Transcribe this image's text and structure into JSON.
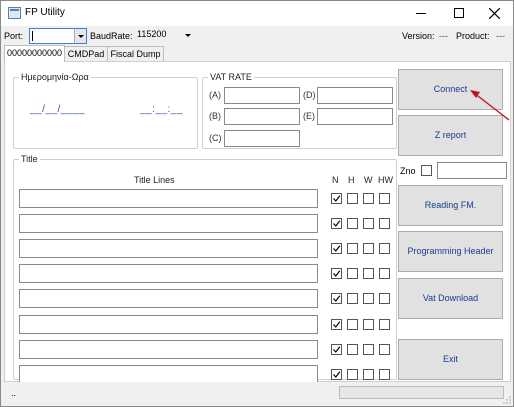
{
  "window": {
    "title": "FP Utility"
  },
  "toolbar": {
    "port_label": "Port:",
    "port_value": "",
    "baud_label": "BaudRate:",
    "baud_value": "115200",
    "version_label": "Version:",
    "version_value": "---",
    "product_label": "Product:",
    "product_value": "---"
  },
  "tabs": [
    {
      "label": "00000000000"
    },
    {
      "label": "CMDPad"
    },
    {
      "label": "Fiscal Dump"
    }
  ],
  "datetime": {
    "label": "Ημερομηνία-Ωρα",
    "date_value": "__/__/____",
    "time_value": "__:__:__"
  },
  "vat": {
    "label": "VAT RATE",
    "rates": [
      {
        "label": "(A)",
        "value": ""
      },
      {
        "label": "(B)",
        "value": ""
      },
      {
        "label": "(C)",
        "value": ""
      },
      {
        "label": "(D)",
        "value": ""
      },
      {
        "label": "(E)",
        "value": ""
      }
    ]
  },
  "title_group": {
    "label": "Title",
    "lines_header": "Title Lines",
    "col_n": "N",
    "col_h": "H",
    "col_w": "W",
    "col_hw": "HW",
    "rows": [
      {
        "value": "",
        "n": true,
        "h": false,
        "w": false,
        "hw": false
      },
      {
        "value": "",
        "n": true,
        "h": false,
        "w": false,
        "hw": false
      },
      {
        "value": "",
        "n": true,
        "h": false,
        "w": false,
        "hw": false
      },
      {
        "value": "",
        "n": true,
        "h": false,
        "w": false,
        "hw": false
      },
      {
        "value": "",
        "n": true,
        "h": false,
        "w": false,
        "hw": false
      },
      {
        "value": "",
        "n": true,
        "h": false,
        "w": false,
        "hw": false
      },
      {
        "value": "",
        "n": true,
        "h": false,
        "w": false,
        "hw": false
      },
      {
        "value": "",
        "n": true,
        "h": false,
        "w": false,
        "hw": false
      }
    ]
  },
  "actions": {
    "connect": "Connect",
    "z_report": "Z report",
    "zno_label": "Zno",
    "zno_value": "",
    "reading_fm": "Reading FM.",
    "programming_header": "Programming Header",
    "vat_download": "Vat Download",
    "exit": "Exit"
  },
  "status": {
    "text": ".."
  },
  "colors": {
    "accent_text": "#1a3d8f",
    "annotation_arrow": "#c0141c"
  }
}
